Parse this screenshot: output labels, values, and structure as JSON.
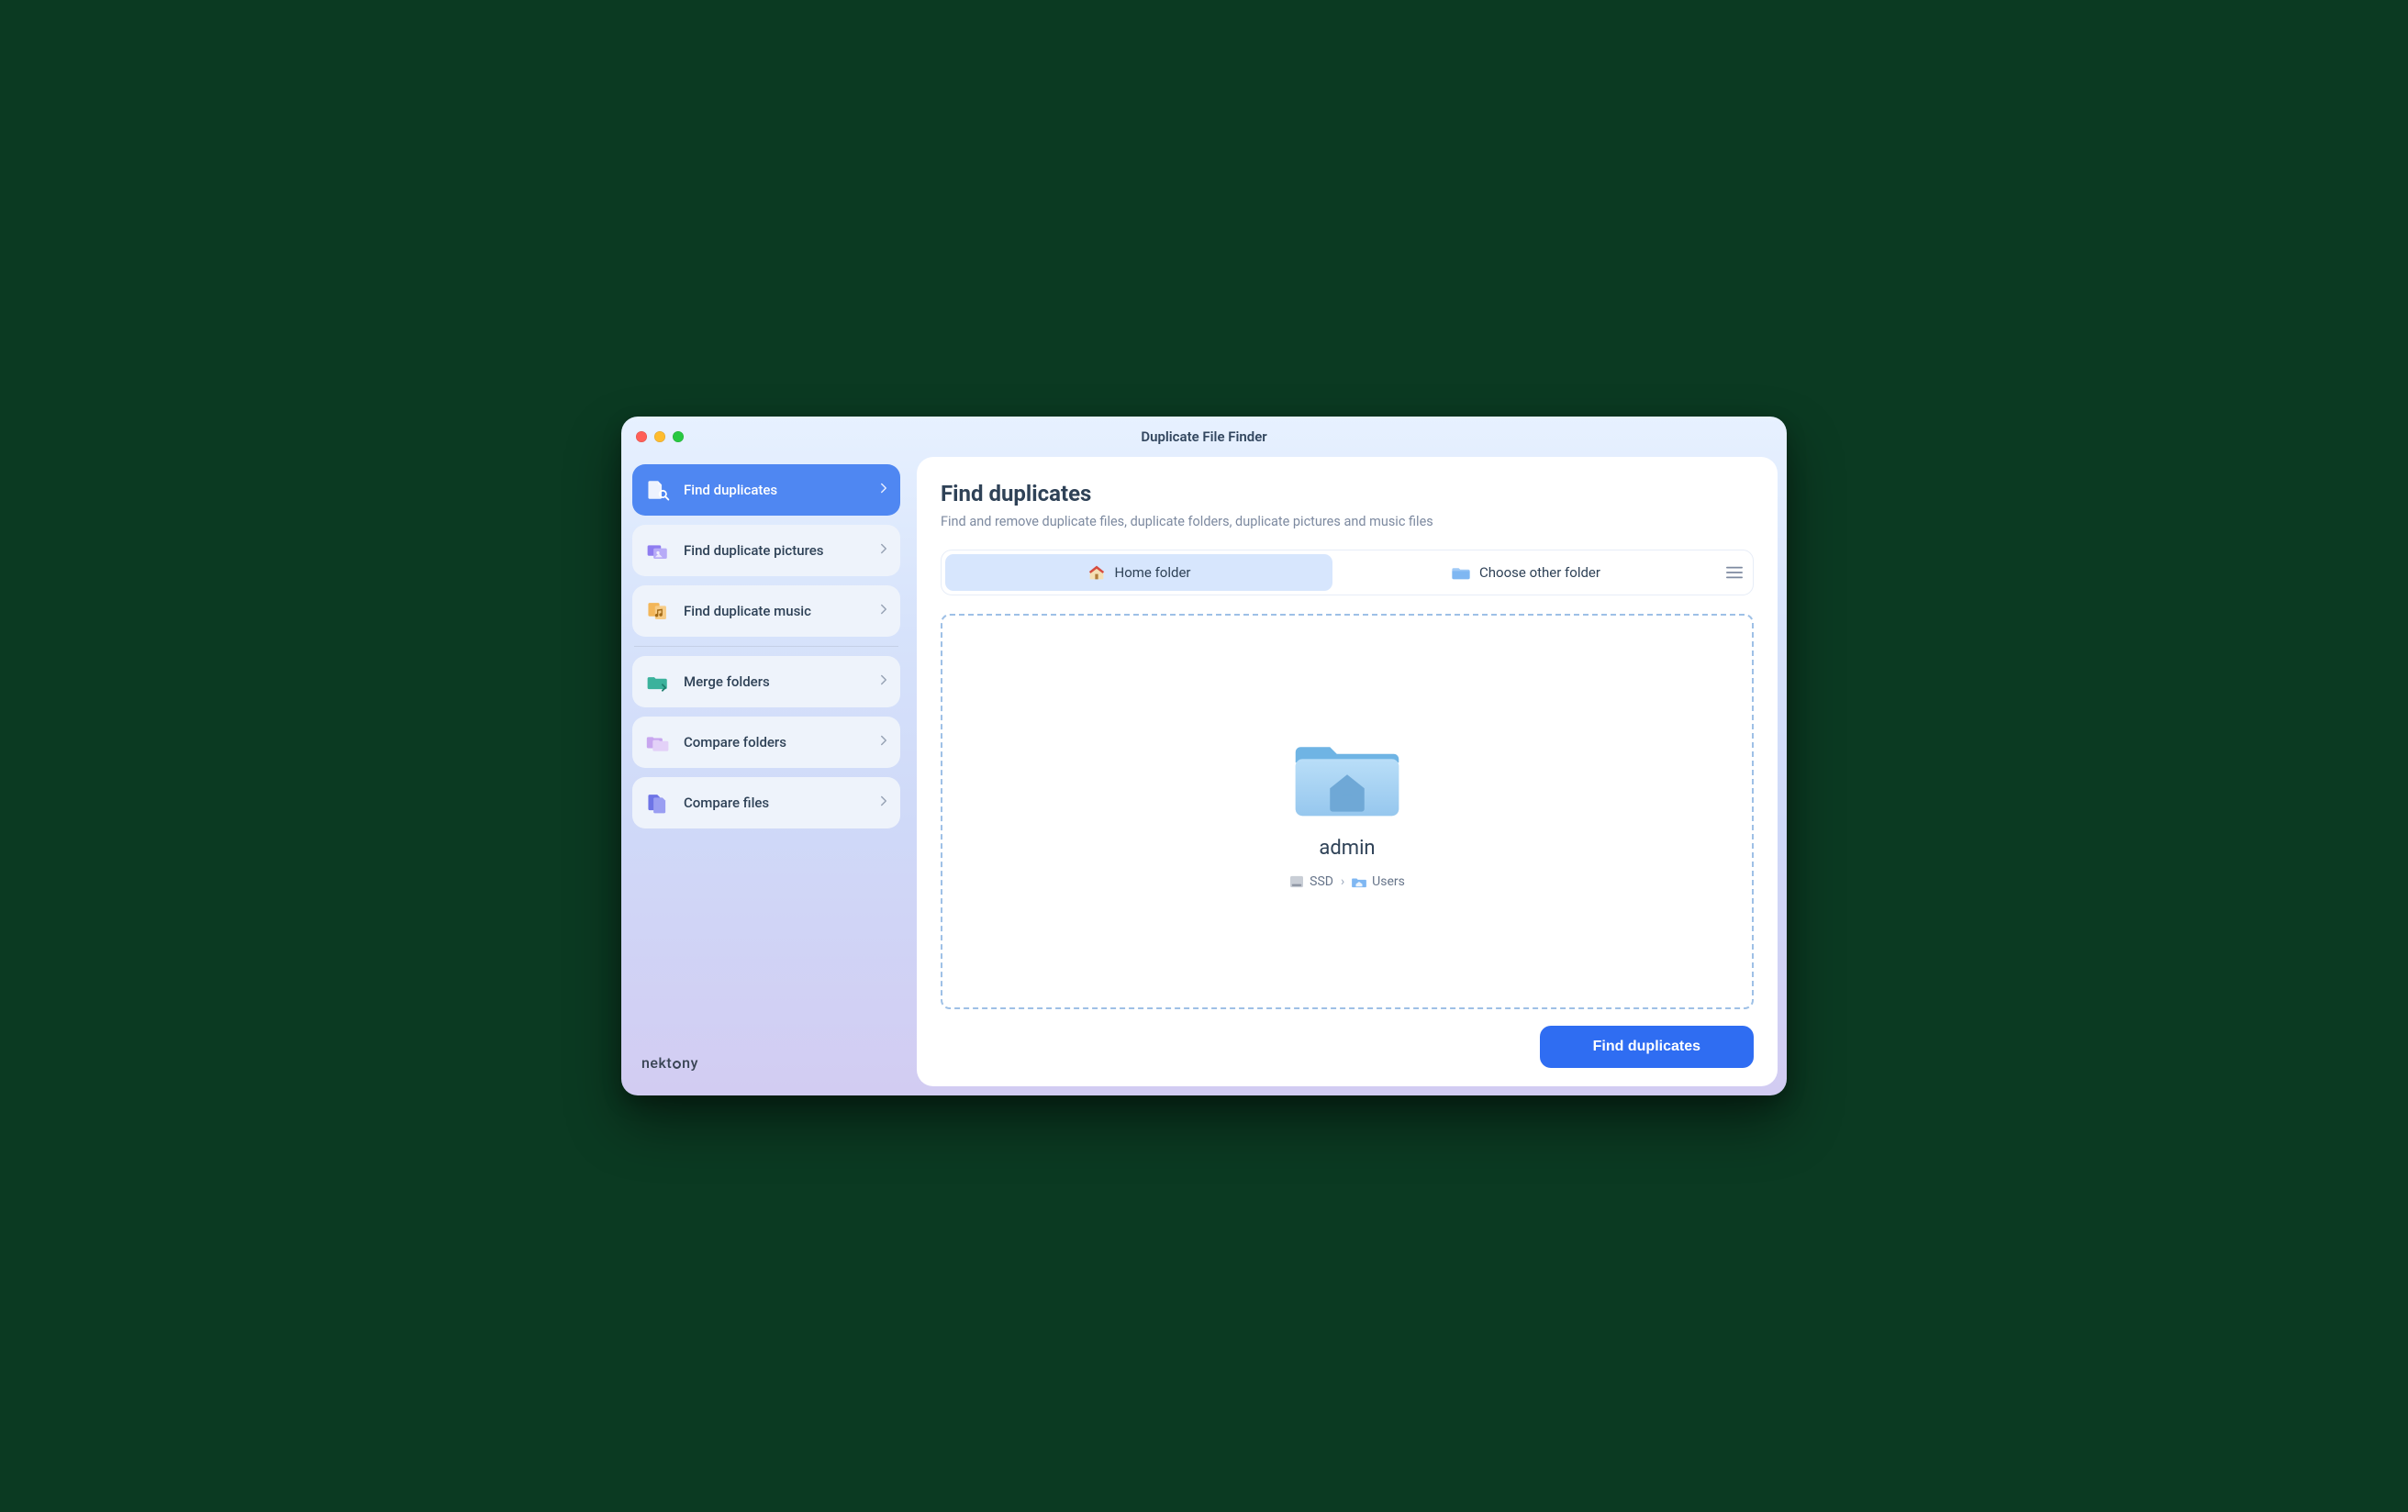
{
  "app": {
    "title": "Duplicate File Finder",
    "brand": "nektony"
  },
  "sidebar": {
    "groups": [
      {
        "items": [
          {
            "key": "find-duplicates",
            "label": "Find duplicates",
            "icon": "doc-search",
            "active": true
          },
          {
            "key": "find-pictures",
            "label": "Find duplicate pictures",
            "icon": "pictures"
          },
          {
            "key": "find-music",
            "label": "Find duplicate music",
            "icon": "music"
          }
        ]
      },
      {
        "items": [
          {
            "key": "merge-folders",
            "label": "Merge folders",
            "icon": "merge-folder"
          },
          {
            "key": "compare-folders",
            "label": "Compare folders",
            "icon": "compare-folders"
          },
          {
            "key": "compare-files",
            "label": "Compare files",
            "icon": "compare-files"
          }
        ]
      }
    ]
  },
  "main": {
    "heading": "Find duplicates",
    "subtitle": "Find and remove duplicate files, duplicate folders, duplicate pictures and music files",
    "segmented": {
      "active": "home",
      "home_label": "Home folder",
      "other_label": "Choose other folder"
    },
    "selection": {
      "name": "admin",
      "breadcrumbs": [
        {
          "icon": "disk",
          "label": "SSD"
        },
        {
          "icon": "homefolder",
          "label": "Users"
        }
      ]
    },
    "cta_label": "Find duplicates"
  }
}
